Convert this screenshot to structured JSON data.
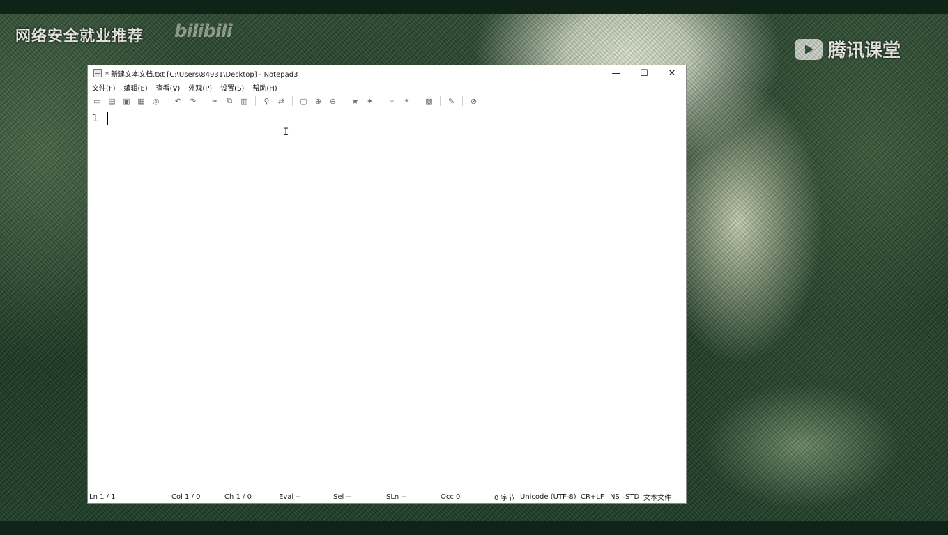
{
  "overlay": {
    "left_caption": "网络安全就业推荐",
    "left_logo": "bilibili",
    "right_caption": "腾讯课堂"
  },
  "window": {
    "title": "* 新建文本文档.txt [C:\\Users\\84931\\Desktop] - Notepad3",
    "controls": {
      "minimize": "—",
      "maximize": "☐",
      "close": "✕"
    }
  },
  "menu": [
    "文件(F)",
    "编辑(E)",
    "查看(V)",
    "外观(P)",
    "设置(S)",
    "帮助(H)"
  ],
  "toolbar_icons": [
    "new-icon",
    "open-icon",
    "save-icon",
    "save-as-icon",
    "browse-icon",
    "undo-icon",
    "redo-icon",
    "cut-icon",
    "copy-icon",
    "paste-icon",
    "find-icon",
    "replace-icon",
    "wordwrap-icon",
    "zoom-in-icon",
    "zoom-out-icon",
    "bookmark-icon",
    "bookmark-next-icon",
    "zoom-fit-icon",
    "zoom-reset-icon",
    "scheme-icon",
    "pin-icon",
    "exit-icon"
  ],
  "editor": {
    "line_numbers": [
      "1"
    ],
    "content": ""
  },
  "status": {
    "ln": "Ln  1 / 1",
    "col": "Col  1 / 0",
    "ch": "Ch  1 / 0",
    "eval": "Eval  --",
    "sel": "Sel  --",
    "sln": "SLn  --",
    "occ": "Occ  0",
    "bytes": "0 字节",
    "encoding": "Unicode (UTF-8)",
    "eol": "CR+LF",
    "ins": "INS",
    "std": "STD",
    "lexer": "文本文件"
  },
  "colors": {
    "window_bg": "#ffffff",
    "border": "#8a8a8a",
    "desktop_dark": "#1d3a24"
  }
}
